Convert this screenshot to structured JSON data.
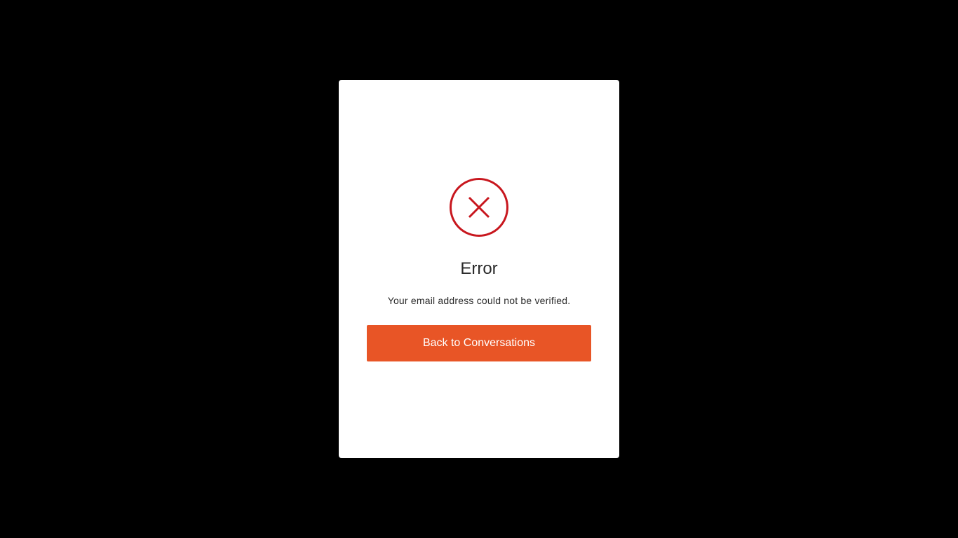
{
  "dialog": {
    "title": "Error",
    "message": "Your email address could not be verified.",
    "button_label": "Back to Conversations",
    "icon": "error-circle-x-icon"
  },
  "colors": {
    "backdrop": "#000000",
    "dialog_background": "#ffffff",
    "error_red": "#c8171e",
    "button_background": "#e85526",
    "button_text": "#ffffff",
    "text": "#2b2b2b"
  }
}
